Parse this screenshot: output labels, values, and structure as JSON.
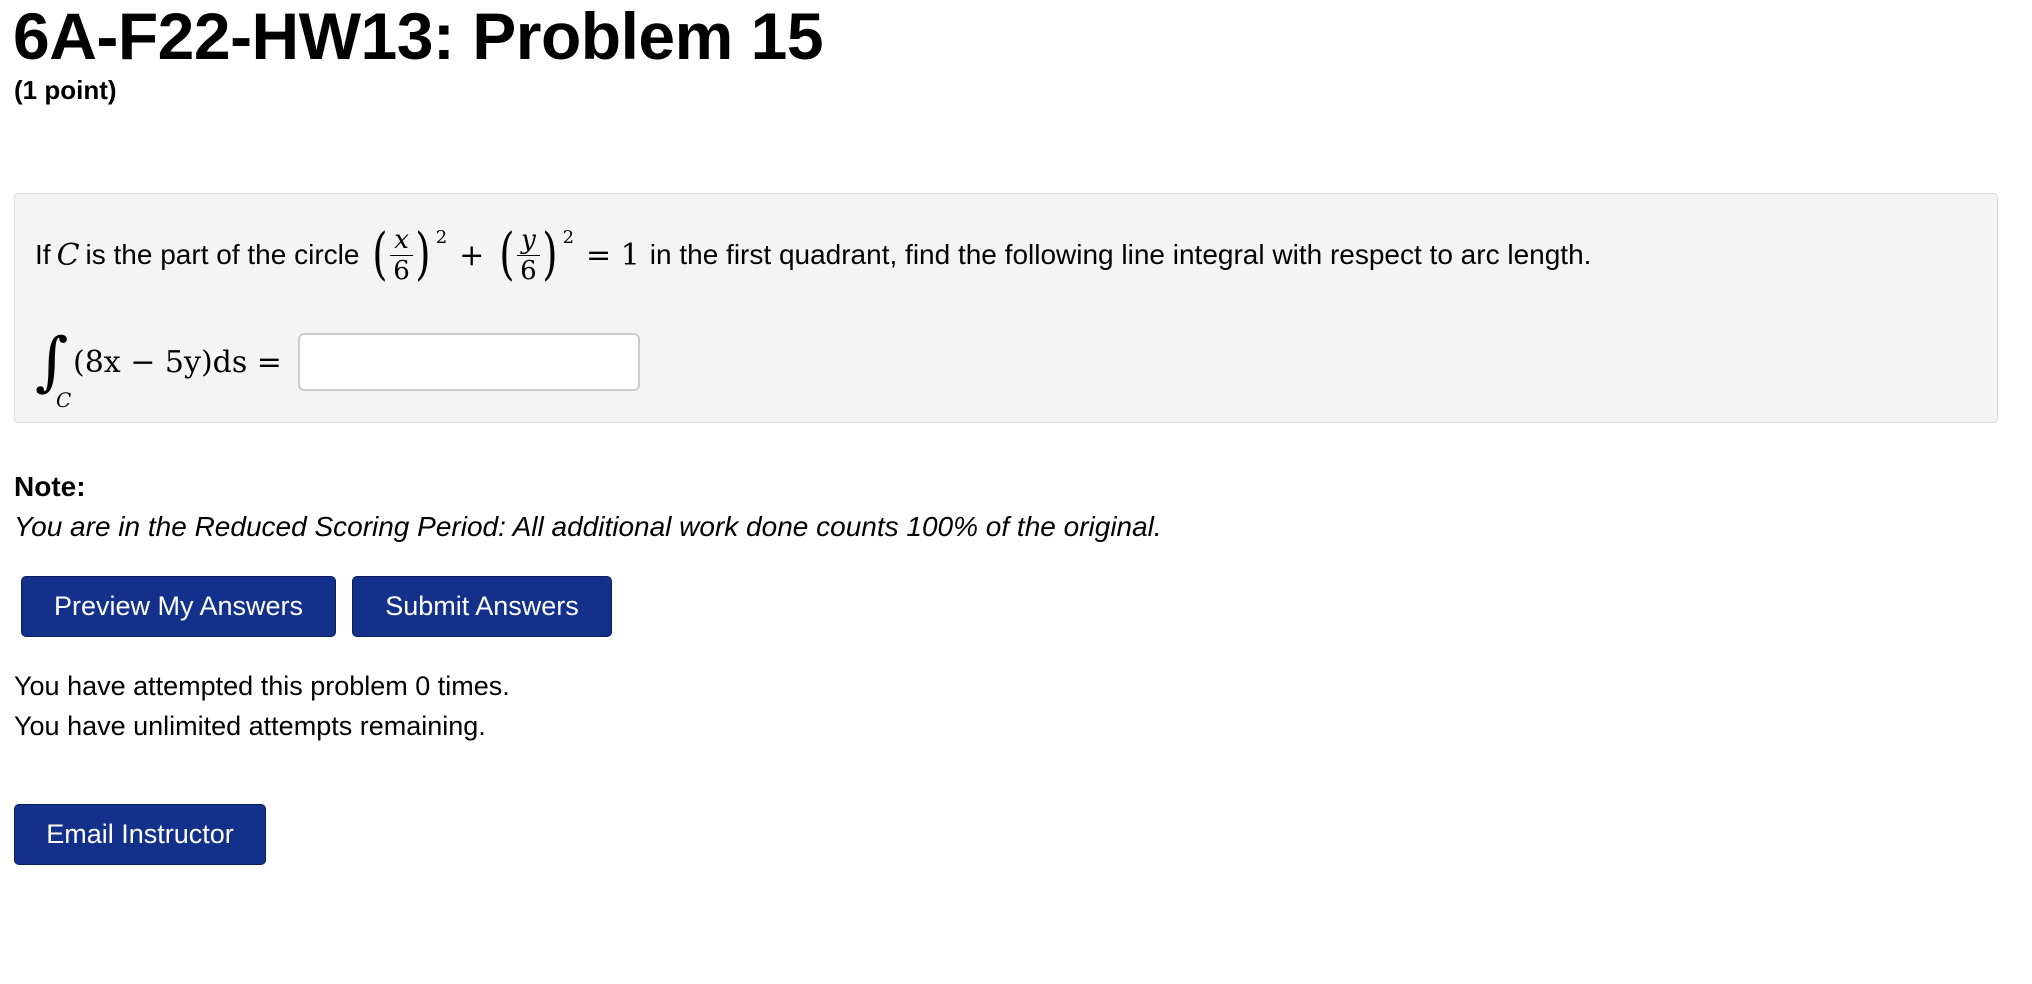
{
  "page": {
    "title": "6A-F22-HW13: Problem 15",
    "points": "(1 point)"
  },
  "problem": {
    "intro": "If",
    "var_c": "C",
    "mid_text": "is the part of the circle",
    "frac_x_num": "x",
    "frac_x_den": "6",
    "frac_y_num": "y",
    "frac_y_den": "6",
    "exponent": "2",
    "plus": "+",
    "equals_one": "= 1",
    "end_text": "in the first quadrant, find the following line integral with respect to arc length.",
    "integral_symbol": "∫",
    "integral_sub": "C",
    "integrand": "(8x − 5y)ds =",
    "answer_value": "",
    "answer_placeholder": ""
  },
  "note": {
    "label": "Note:",
    "text": "You are in the Reduced Scoring Period: All additional work done counts 100% of the original."
  },
  "buttons": {
    "preview": "Preview My Answers",
    "submit": "Submit Answers",
    "email": "Email Instructor"
  },
  "status": {
    "attempted": "You have attempted this problem 0 times.",
    "remaining": "You have unlimited attempts remaining."
  },
  "colors": {
    "button_bg": "#13318b",
    "problem_bg": "#f4f4f4"
  }
}
